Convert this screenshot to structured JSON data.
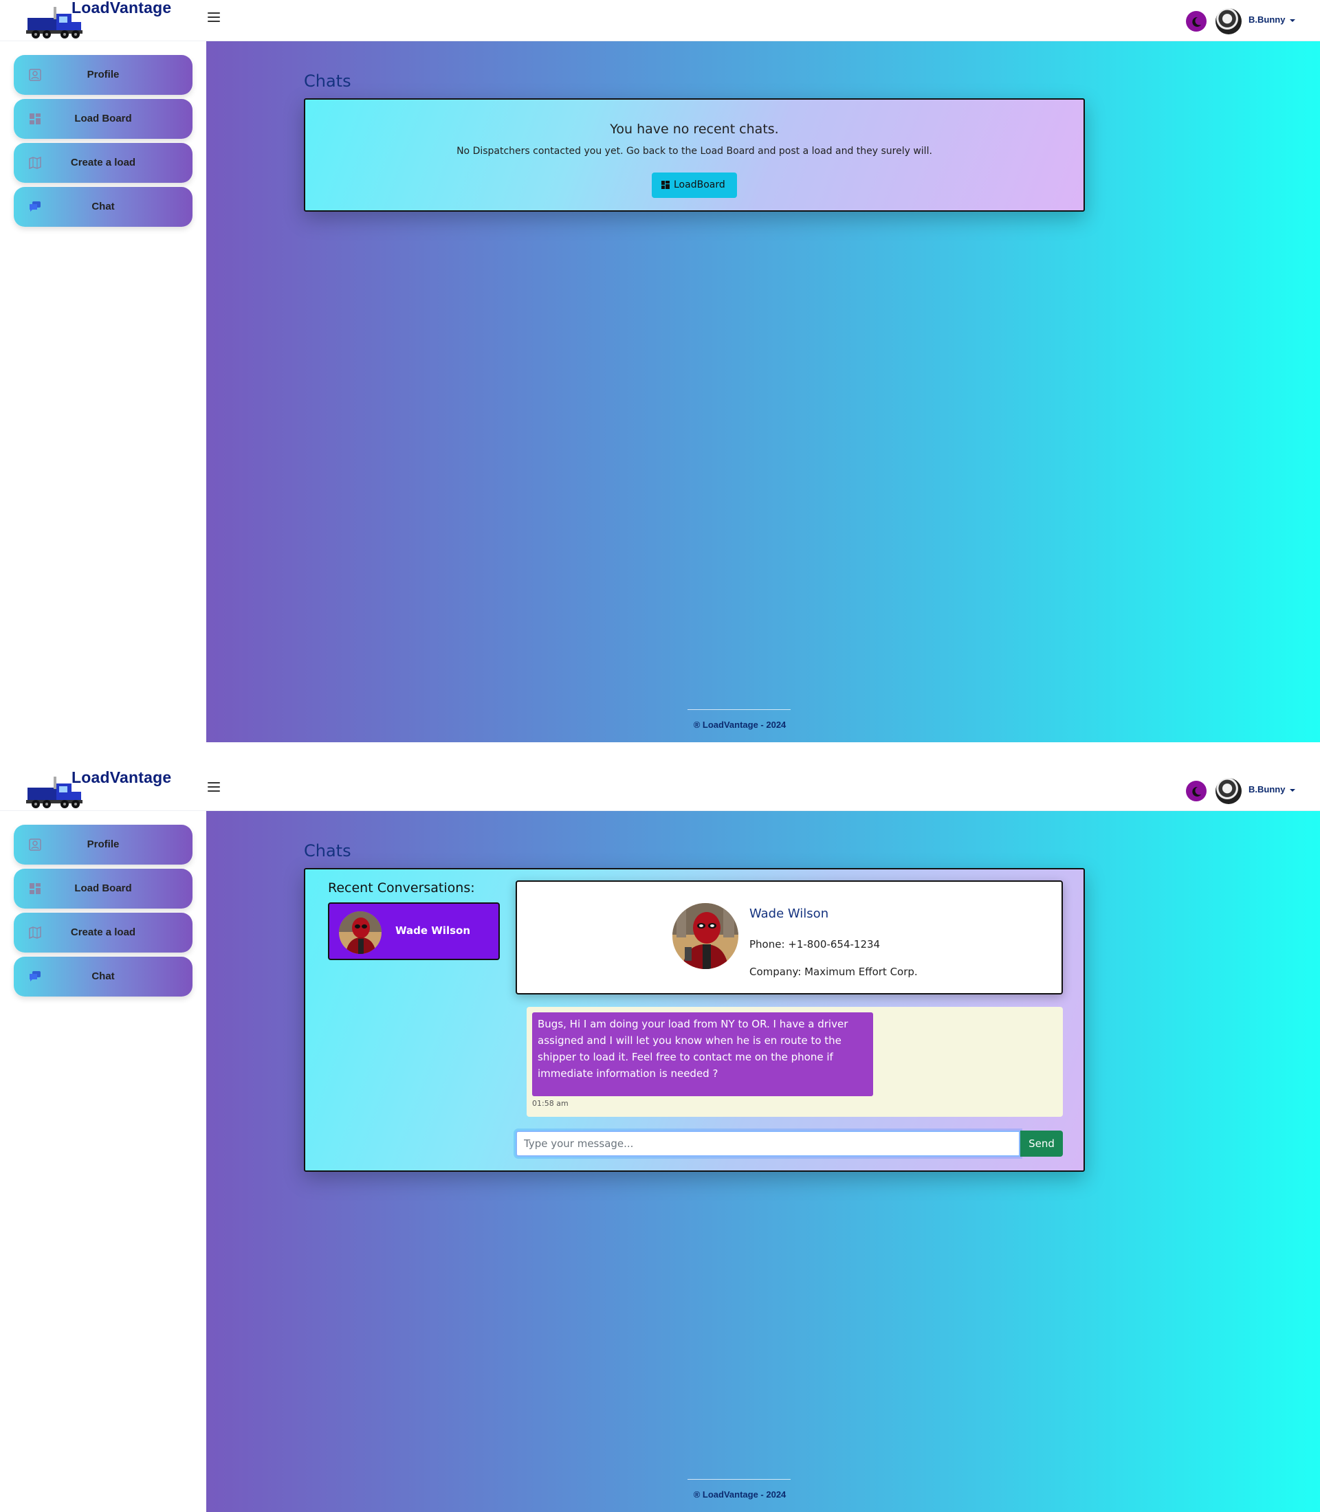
{
  "brand": {
    "name": "LoadVantage"
  },
  "user": {
    "name": "B.Bunny"
  },
  "theme": {
    "toggle_color": "#8a0f9c"
  },
  "sidebar": {
    "items": [
      {
        "label": "Profile",
        "icon": "profile-icon"
      },
      {
        "label": "Load Board",
        "icon": "dashboard-icon"
      },
      {
        "label": "Create a load",
        "icon": "map-icon"
      },
      {
        "label": "Chat",
        "icon": "chat-icon"
      }
    ]
  },
  "page_title": "Chats",
  "empty_state": {
    "title": "You have no recent chats.",
    "text": "No Dispatchers contacted you yet. Go back to the Load Board and post a load and they surely will.",
    "button_label": "LoadBoard"
  },
  "conversations": {
    "title": "Recent Conversations:",
    "items": [
      {
        "name": "Wade Wilson"
      }
    ]
  },
  "contact": {
    "name": "Wade Wilson",
    "phone": "Phone: +1-800-654-1234",
    "company": "Company: Maximum Effort Corp."
  },
  "messages": [
    {
      "text": "Bugs, Hi I am doing your load from NY to OR. I have a driver assigned and I will let you know when he is en route to the shipper to load it. Feel free to contact me on the phone if immediate information is needed ?",
      "time": "01:58 am"
    }
  ],
  "composer": {
    "placeholder": "Type your message...",
    "send_label": "Send"
  },
  "footer": {
    "text": "® LoadVantage - 2024"
  }
}
